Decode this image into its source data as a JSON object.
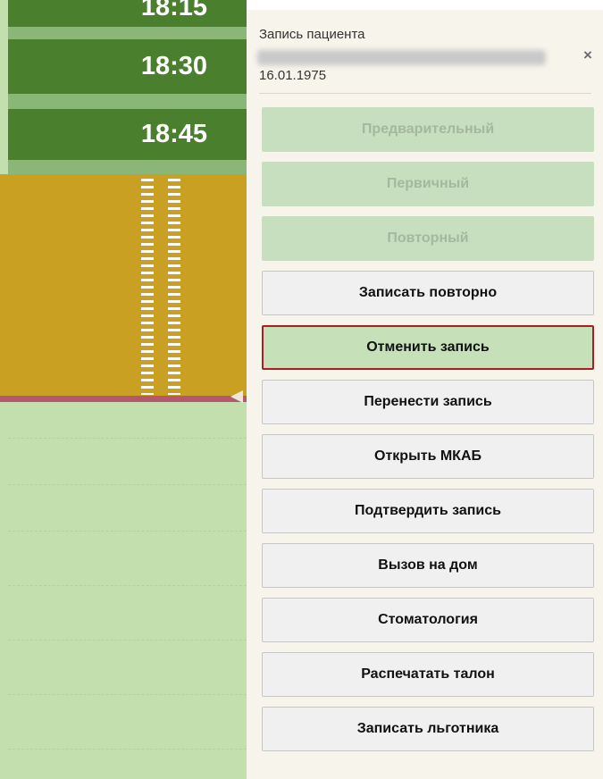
{
  "schedule": {
    "slots": [
      {
        "time": "18:15"
      },
      {
        "time": "18:30"
      },
      {
        "time": "18:45"
      }
    ]
  },
  "panel": {
    "title": "Запись пациента",
    "dob": "16.01.1975",
    "close_symbol": "×",
    "buttons": [
      {
        "label": "Предварительный",
        "state": "disabled"
      },
      {
        "label": "Первичный",
        "state": "disabled"
      },
      {
        "label": "Повторный",
        "state": "disabled"
      },
      {
        "label": "Записать повторно",
        "state": "enabled"
      },
      {
        "label": "Отменить запись",
        "state": "highlighted"
      },
      {
        "label": "Перенести запись",
        "state": "enabled"
      },
      {
        "label": "Открыть МКАБ",
        "state": "enabled"
      },
      {
        "label": "Подтвердить запись",
        "state": "enabled"
      },
      {
        "label": "Вызов на дом",
        "state": "enabled"
      },
      {
        "label": "Стоматология",
        "state": "enabled"
      },
      {
        "label": "Распечатать талон",
        "state": "enabled"
      },
      {
        "label": "Записать льготника",
        "state": "enabled"
      }
    ]
  },
  "colors": {
    "slot_green": "#4a7f2e",
    "free_green": "#c2dfad",
    "booked_gold": "#c9a021",
    "active_border": "#a71f23",
    "disabled_button": "#c8dfbf"
  }
}
